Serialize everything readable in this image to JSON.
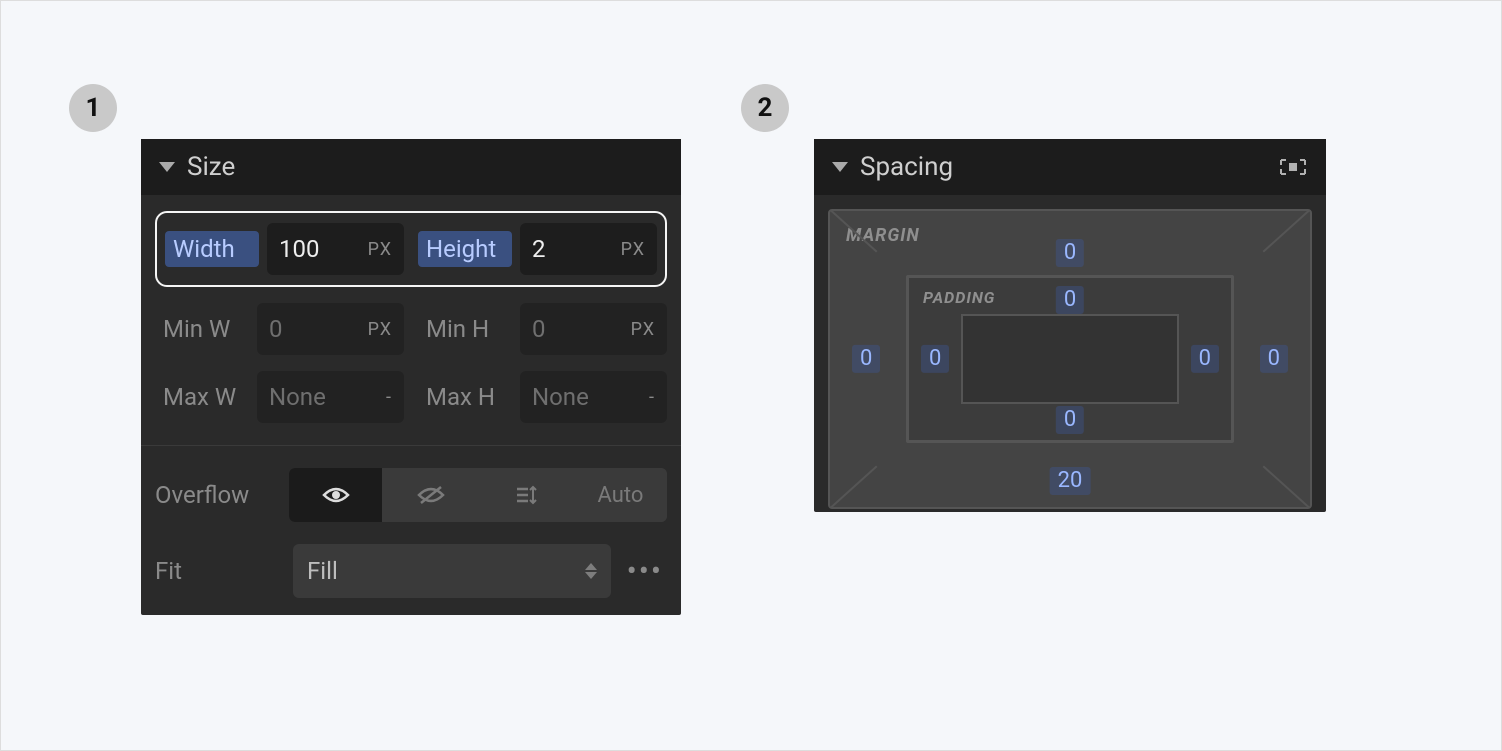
{
  "badges": {
    "one": "1",
    "two": "2"
  },
  "size": {
    "title": "Size",
    "width": {
      "label": "Width",
      "value": "100",
      "unit": "PX"
    },
    "height": {
      "label": "Height",
      "value": "2",
      "unit": "PX"
    },
    "minw": {
      "label": "Min W",
      "value": "0",
      "unit": "PX"
    },
    "minh": {
      "label": "Min H",
      "value": "0",
      "unit": "PX"
    },
    "maxw": {
      "label": "Max W",
      "value": "None",
      "unit": "-"
    },
    "maxh": {
      "label": "Max H",
      "value": "None",
      "unit": "-"
    },
    "overflow": {
      "label": "Overflow",
      "auto": "Auto"
    },
    "fit": {
      "label": "Fit",
      "value": "Fill"
    }
  },
  "spacing": {
    "title": "Spacing",
    "margin_label": "MARGIN",
    "padding_label": "PADDING",
    "margin": {
      "top": "0",
      "right": "0",
      "bottom": "20",
      "left": "0"
    },
    "padding": {
      "top": "0",
      "right": "0",
      "bottom": "0",
      "left": "0"
    }
  }
}
